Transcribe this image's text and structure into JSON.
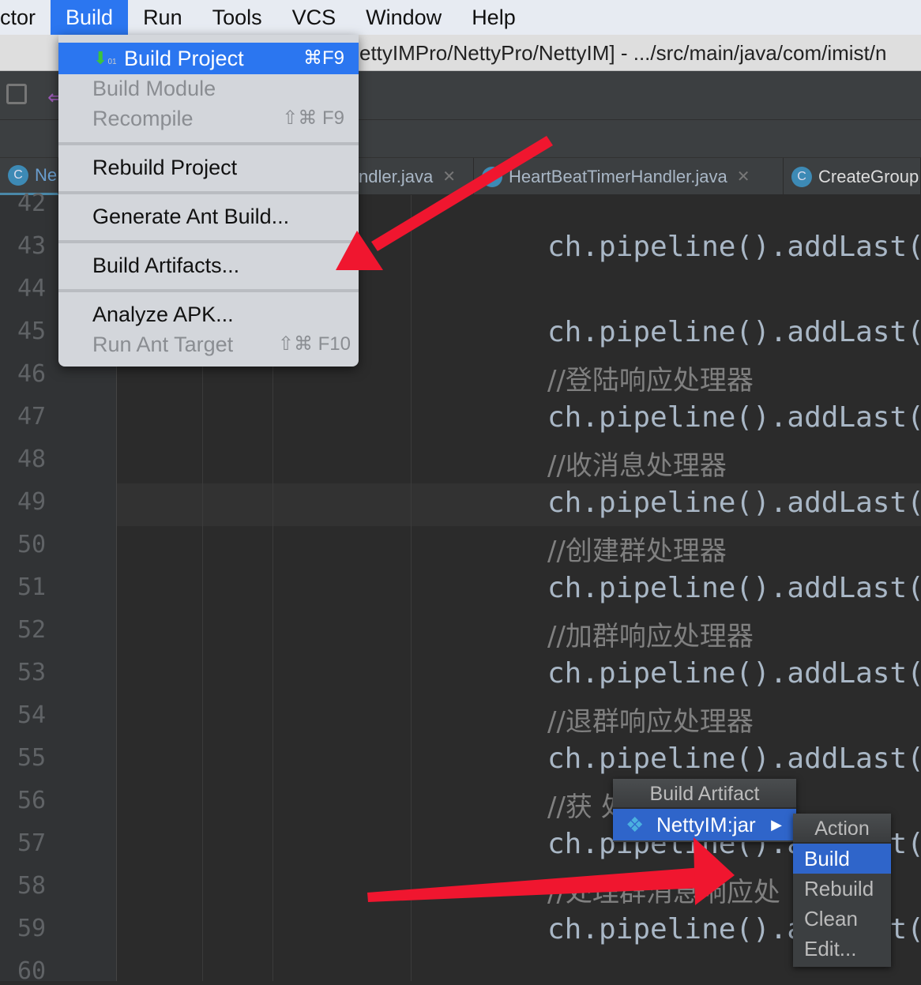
{
  "menubar": {
    "items": [
      "ctor",
      "Build",
      "Run",
      "Tools",
      "VCS",
      "Window",
      "Help"
    ],
    "active": "Build"
  },
  "title": "ettyIMPro/NettyPro/NettyIM] - .../src/main/java/com/imist/n",
  "tabs": [
    {
      "label": "Ne"
    },
    {
      "label": "ndler.java"
    },
    {
      "label": "HeartBeatTimerHandler.java"
    },
    {
      "label": "CreateGroup"
    }
  ],
  "build_menu": {
    "items": [
      {
        "label": "Build Project",
        "shortcut": "⌘F9",
        "state": "selected",
        "icon": "build-project-icon"
      },
      {
        "label": "Build Module",
        "state": "disabled"
      },
      {
        "label": "Recompile",
        "shortcut": "⇧⌘ F9",
        "state": "disabled"
      },
      {
        "label": "Rebuild Project"
      },
      {
        "label": "Generate Ant Build..."
      },
      {
        "label": "Build Artifacts..."
      },
      {
        "label": "Analyze APK..."
      },
      {
        "label": "Run Ant Target",
        "shortcut": "⇧⌘ F10",
        "state": "disabled"
      }
    ]
  },
  "line_numbers": [
    "42",
    "43",
    "44",
    "45",
    "46",
    "47",
    "48",
    "49",
    "50",
    "51",
    "52",
    "53",
    "54",
    "55",
    "56",
    "57",
    "58",
    "59",
    "60"
  ],
  "code_lines": [
    {
      "line": "43",
      "text": "ch.pipeline().addLast("
    },
    {
      "line": "45",
      "text": "ch.pipeline().addLast("
    },
    {
      "line": "46",
      "text": "//登陆响应处理器",
      "comment": true
    },
    {
      "line": "47",
      "text": "ch.pipeline().addLast("
    },
    {
      "line": "48",
      "text": "//收消息处理器",
      "comment": true
    },
    {
      "line": "49",
      "text": "ch.pipeline().addLast("
    },
    {
      "line": "50",
      "text": "//创建群处理器",
      "comment": true
    },
    {
      "line": "51",
      "text": "ch.pipeline().addLast("
    },
    {
      "line": "52",
      "text": "//加群响应处理器",
      "comment": true
    },
    {
      "line": "53",
      "text": "ch.pipeline().addLast("
    },
    {
      "line": "54",
      "text": "//退群响应处理器",
      "comment": true
    },
    {
      "line": "55",
      "text": "ch.pipeline().addLast("
    },
    {
      "line": "56",
      "text": "//获        处理器",
      "comment": true
    },
    {
      "line": "57",
      "text": "ch.pipeline().addLast("
    },
    {
      "line": "58",
      "text": "//处理群消息响应处",
      "comment": true
    },
    {
      "line": "59",
      "text": "ch.pipeline().addLast("
    }
  ],
  "artifact_popup": {
    "title": "Build Artifact",
    "item": "NettyIM:jar"
  },
  "action_popup": {
    "title": "Action",
    "items": [
      "Build",
      "Rebuild",
      "Clean",
      "Edit..."
    ],
    "selected": "Build"
  },
  "colors": {
    "accent": "#2b76f0",
    "annotation_arrow": "#f0162f",
    "editor_bg": "#2b2b2b"
  }
}
